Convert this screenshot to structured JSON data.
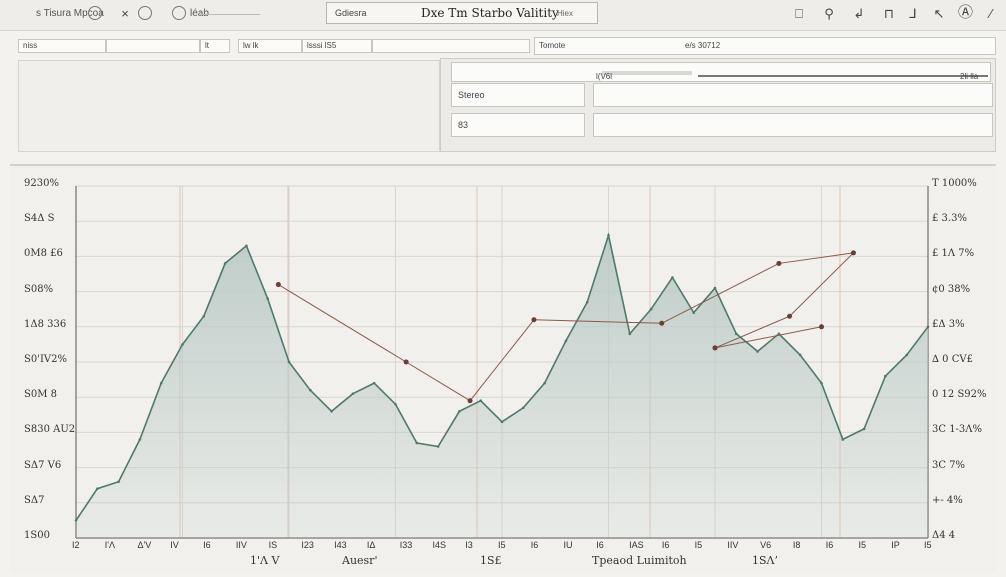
{
  "toolbar": {
    "left_text": "s Tisura Mpcoa",
    "mid_text": "léab",
    "title_box_left": "Gdiesra",
    "title": "Dxe Tm Starbo Valitity",
    "title_suffix": "Hiex",
    "icon_names": [
      "bookmark-icon",
      "pin-icon",
      "export-icon",
      "clipboard-icon",
      "edit-icon",
      "cursor-icon",
      "text-format-icon"
    ]
  },
  "second_row": {
    "fields": [
      "niss",
      "",
      "lt",
      "lw  lk",
      "lsssi  lS5",
      ""
    ],
    "right_label": "Tomote",
    "right_value": "e/s 30712"
  },
  "right_panel": {
    "header_value": "l(V6l",
    "header_right": "2li lla",
    "row1_label": "Stereo",
    "row2_label": "83"
  },
  "chart_data": {
    "type": "area",
    "title": "",
    "left_yticks": [
      "9230%",
      "S4Δ S",
      "0M8 £6",
      "S08%",
      "1Δ8 336",
      "S0'IV2%",
      "S0M 8",
      "S830 AU2",
      "SΔ7 V6",
      "SΔ7",
      "1S00"
    ],
    "right_yticks": [
      "T 1000%",
      "£ 3.3%",
      "£ 1Λ 7%",
      "¢0 38%",
      "£Δ 3%",
      "∆ 0 CV£",
      "0 12 S92%",
      "3C 1-3Λ%",
      "3C 7%",
      "+- 4%",
      "Δ4 4"
    ],
    "xticks": [
      "I2",
      "I'Λ",
      "Δ'V",
      "IV",
      "I6",
      "IIV",
      "IS",
      "I23",
      "I43",
      "IΔ",
      "I33",
      "I4S",
      "I3",
      "I5",
      "I6",
      "IU",
      "I6",
      "IAS",
      "I6",
      "I5",
      "IIV",
      "V6",
      "I8",
      "I6",
      "I5",
      "IP",
      "I5"
    ],
    "xlabels": [
      "1'Λ V",
      "Auesr'",
      "1S£",
      "Tpeaod Luimitoh",
      "1SΛ’"
    ],
    "x": [
      0,
      1,
      2,
      3,
      4,
      5,
      6,
      7,
      8,
      9,
      10,
      11,
      12,
      13,
      14,
      15,
      16,
      17,
      18,
      19,
      20,
      21,
      22,
      23,
      24,
      25,
      26,
      27,
      28,
      29,
      30,
      31,
      32,
      33,
      34,
      35,
      36,
      37,
      38,
      39,
      40
    ],
    "series": [
      {
        "values": [
          5,
          14,
          16,
          28,
          44,
          55,
          63,
          78,
          83,
          68,
          50,
          42,
          36,
          41,
          44,
          38,
          27,
          26,
          36,
          39,
          33,
          37,
          44,
          56,
          67,
          86,
          58,
          65,
          74,
          64,
          71,
          58,
          53,
          58,
          52,
          44,
          28,
          31,
          46,
          52,
          60
        ]
      }
    ],
    "trend_points": [
      {
        "x": 9.5,
        "y": 72
      },
      {
        "x": 15.5,
        "y": 50
      },
      {
        "x": 18.5,
        "y": 39
      },
      {
        "x": 21.5,
        "y": 62
      },
      {
        "x": 27.5,
        "y": 61
      },
      {
        "x": 33.0,
        "y": 78
      },
      {
        "x": 36.5,
        "y": 81
      },
      {
        "x": 33.5,
        "y": 63
      },
      {
        "x": 30.0,
        "y": 54
      },
      {
        "x": 35.0,
        "y": 60
      }
    ],
    "ylim": [
      0,
      100
    ],
    "xlim": [
      0,
      40
    ],
    "grid": true
  },
  "colors": {
    "area_fill": "#bccbc7",
    "area_stroke": "#4d7a6b",
    "trend_line": "#8a5a4a",
    "grid": "#d8d6d1",
    "accent_line": "#e3b9a6"
  }
}
